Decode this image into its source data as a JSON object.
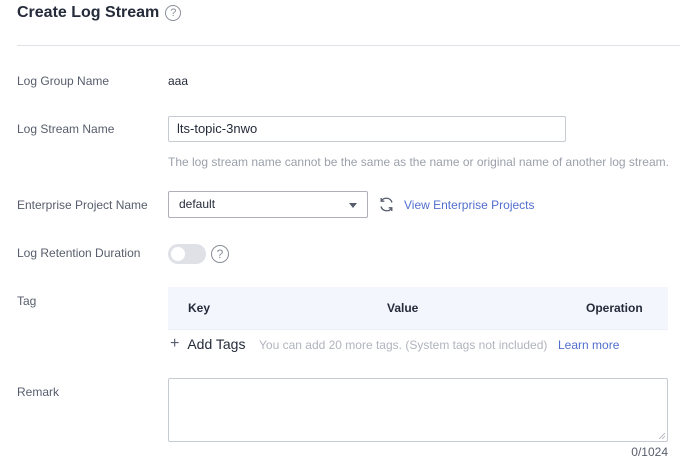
{
  "header": {
    "title": "Create Log Stream",
    "help_glyph": "?"
  },
  "log_group": {
    "label": "Log Group Name",
    "value": "aaa"
  },
  "log_stream": {
    "label": "Log Stream Name",
    "value": "lts-topic-3nwo",
    "hint": "The log stream name cannot be the same as the name or original name of another log stream."
  },
  "enterprise_project": {
    "label": "Enterprise Project Name",
    "selected": "default",
    "link": "View Enterprise Projects"
  },
  "retention": {
    "label": "Log Retention Duration",
    "enabled": false,
    "help_glyph": "?"
  },
  "tag": {
    "label": "Tag",
    "columns": [
      "Key",
      "Value",
      "Operation"
    ],
    "add_label": "Add Tags",
    "note": "You can add 20 more tags. (System tags not included)",
    "learn_more": "Learn more"
  },
  "remark": {
    "label": "Remark",
    "value": "",
    "counter": "0/1024"
  },
  "colors": {
    "link": "#526ecc",
    "toggle_off": "#dfe1e6",
    "table_header": "#f3f6fd"
  }
}
